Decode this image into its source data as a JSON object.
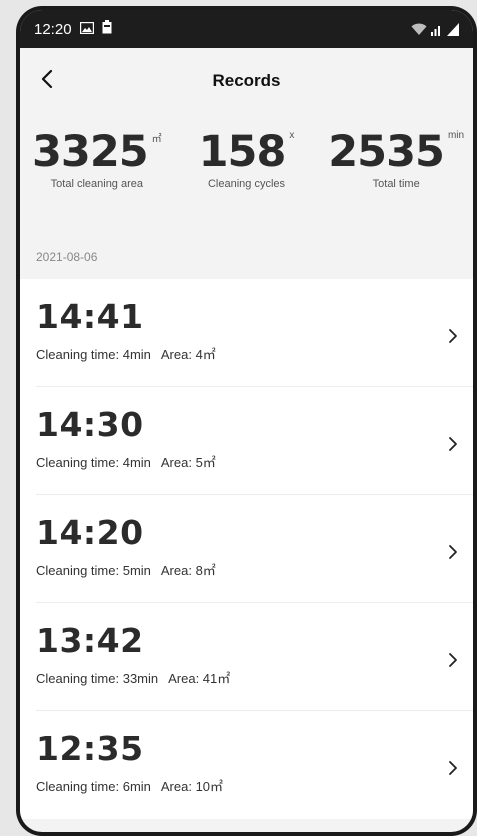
{
  "status_bar": {
    "time": "12:20"
  },
  "header": {
    "title": "Records"
  },
  "stats": [
    {
      "value": "3325",
      "unit": "㎡",
      "label": "Total cleaning area"
    },
    {
      "value": "158",
      "unit": "x",
      "label": "Cleaning cycles"
    },
    {
      "value": "2535",
      "unit": "min",
      "label": "Total time"
    }
  ],
  "date": "2021-08-06",
  "records": [
    {
      "time": "14:41",
      "cleaning_time": "Cleaning time: 4min",
      "area": "Area: 4㎡"
    },
    {
      "time": "14:30",
      "cleaning_time": "Cleaning time: 4min",
      "area": "Area: 5㎡"
    },
    {
      "time": "14:20",
      "cleaning_time": "Cleaning time: 5min",
      "area": "Area: 8㎡"
    },
    {
      "time": "13:42",
      "cleaning_time": "Cleaning time: 33min",
      "area": "Area: 41㎡"
    },
    {
      "time": "12:35",
      "cleaning_time": "Cleaning time: 6min",
      "area": "Area: 10㎡"
    }
  ],
  "icons": {
    "back": "back-arrow-icon",
    "chevron": "chevron-right-icon",
    "gallery": "image-icon",
    "battery_saver": "battery-icon",
    "wifi": "wifi-icon",
    "signal": "signal-icon",
    "battery": "battery-icon"
  }
}
